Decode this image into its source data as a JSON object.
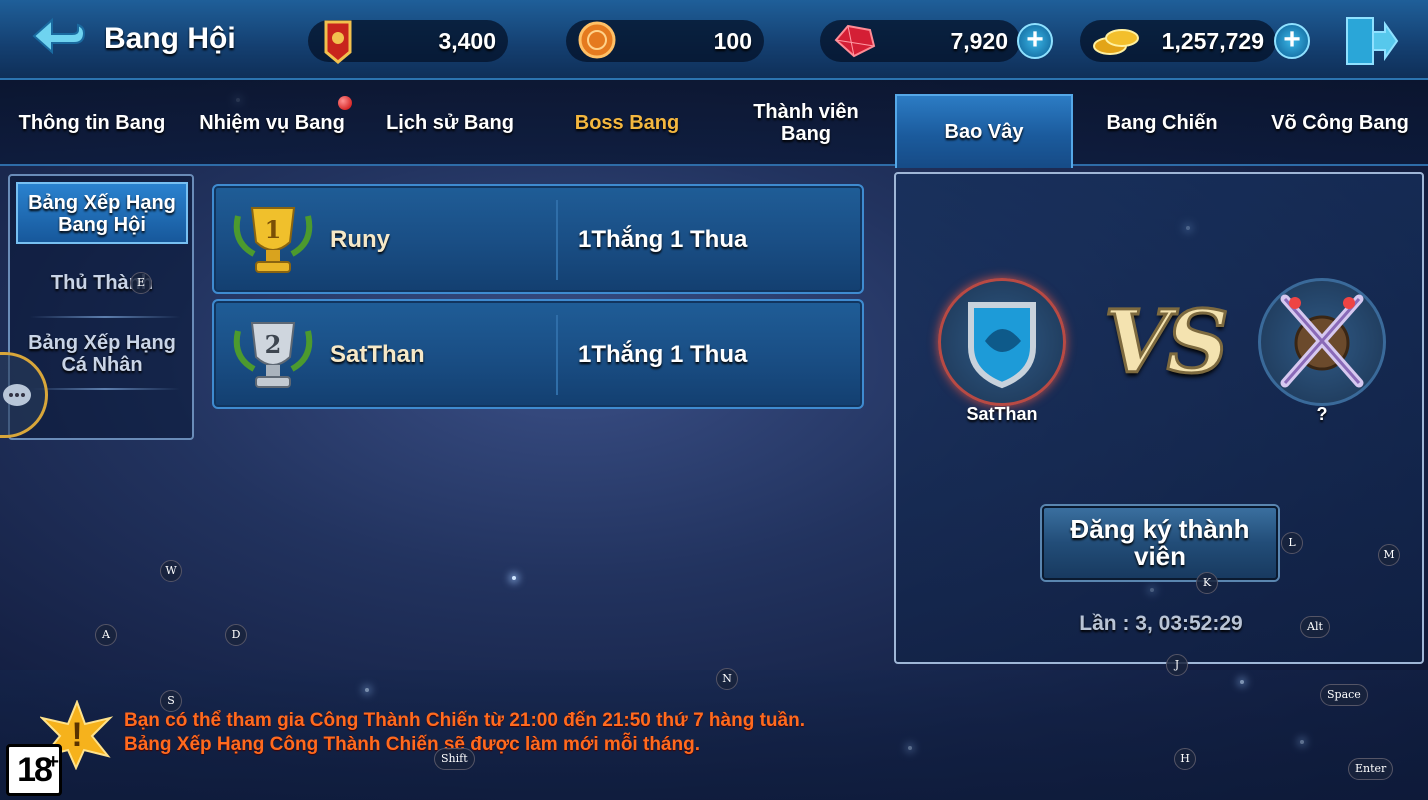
{
  "header": {
    "title": "Bang Hội",
    "resources": [
      {
        "icon": "banner-icon",
        "value": "3,400"
      },
      {
        "icon": "coin-medal-icon",
        "value": "100"
      },
      {
        "icon": "ruby-icon",
        "value": "7,920"
      },
      {
        "icon": "gold-coins-icon",
        "value": "1,257,729"
      }
    ]
  },
  "tabs": [
    {
      "label": "Thông tin Bang"
    },
    {
      "label": "Nhiệm vụ Bang"
    },
    {
      "label": "Lịch sử Bang"
    },
    {
      "label": "Boss Bang"
    },
    {
      "label": "Thành viên Bang"
    },
    {
      "label": "Bao Vây"
    },
    {
      "label": "Bang Chiến"
    },
    {
      "label": "Võ Công Bang"
    }
  ],
  "sidemenu": {
    "items": [
      {
        "label": "Bảng Xếp Hạng Bang Hội"
      },
      {
        "label": "Thủ Thành"
      },
      {
        "label": "Bảng Xếp Hạng Cá Nhân"
      }
    ]
  },
  "rankings": [
    {
      "rank": "1",
      "name": "Runy",
      "record": "1Thắng 1 Thua"
    },
    {
      "rank": "2",
      "name": "SatThan",
      "record": "1Thắng 1 Thua"
    }
  ],
  "siege": {
    "left_guild": "SatThan",
    "vs": "VS",
    "right_guild": "?",
    "register_label": "Đăng ký thành viên",
    "timer": "Lần : 3, 03:52:29"
  },
  "notice": {
    "line1": "Bạn có thể tham gia Công Thành Chiến từ 21:00 đến 21:50 thứ 7 hàng tuần.",
    "line2": "Bảng Xếp Hạng Công Thành Chiến sẽ được làm mới mỗi tháng."
  },
  "age_rating": "18",
  "key_hints": [
    "W",
    "A",
    "D",
    "S",
    "N",
    "Shift",
    "L",
    "M",
    "K",
    "Alt",
    "J",
    "Space",
    "H",
    "Enter",
    "E"
  ],
  "colors": {
    "accent_gold": "#f4b73f",
    "notice_orange": "#ff6a1e"
  }
}
